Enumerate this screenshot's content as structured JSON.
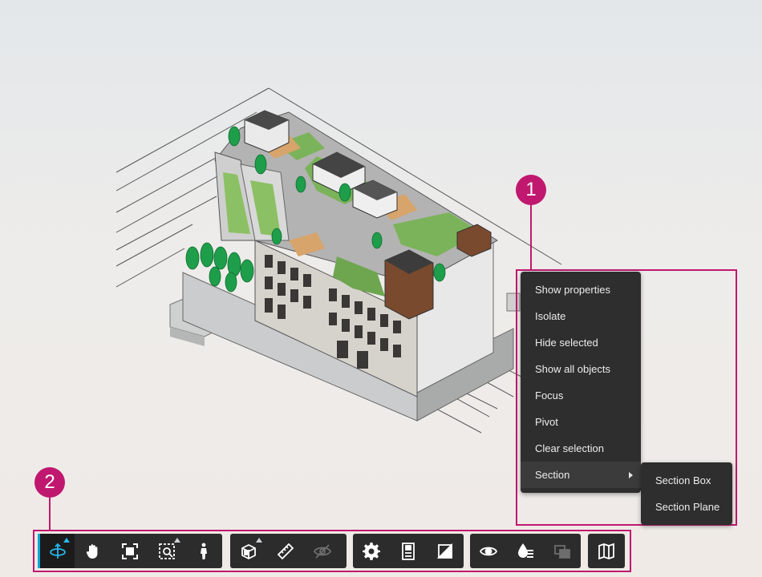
{
  "callouts": {
    "one": "1",
    "two": "2"
  },
  "context_menu": {
    "items": [
      {
        "label": "Show properties"
      },
      {
        "label": "Isolate"
      },
      {
        "label": "Hide selected"
      },
      {
        "label": "Show all objects"
      },
      {
        "label": "Focus"
      },
      {
        "label": "Pivot"
      },
      {
        "label": "Clear selection"
      },
      {
        "label": "Section",
        "has_submenu": true,
        "active": true
      }
    ],
    "submenu": [
      {
        "label": "Section Box"
      },
      {
        "label": "Section Plane"
      }
    ]
  },
  "toolbar": {
    "groups": [
      {
        "name": "navigation",
        "buttons": [
          {
            "icon": "orbit-icon",
            "active": true,
            "has_flyout": true
          },
          {
            "icon": "pan-hand-icon"
          },
          {
            "icon": "fit-to-view-icon"
          },
          {
            "icon": "zoom-window-icon",
            "has_flyout": true
          },
          {
            "icon": "first-person-icon"
          }
        ]
      },
      {
        "name": "tools",
        "buttons": [
          {
            "icon": "section-cube-icon",
            "has_flyout": true
          },
          {
            "icon": "measure-ruler-icon"
          },
          {
            "icon": "hidden-eye-icon",
            "disabled": true
          }
        ]
      },
      {
        "name": "settings",
        "buttons": [
          {
            "icon": "settings-gear-icon"
          },
          {
            "icon": "properties-panel-icon"
          },
          {
            "icon": "full-screen-icon"
          }
        ]
      },
      {
        "name": "visibility",
        "buttons": [
          {
            "icon": "show-eye-icon"
          },
          {
            "icon": "drop-filter-icon"
          },
          {
            "icon": "ghosting-icon",
            "disabled": true
          }
        ]
      },
      {
        "name": "map",
        "buttons": [
          {
            "icon": "map-icon"
          }
        ]
      }
    ]
  },
  "colors": {
    "accent": "#c0186f",
    "active_icon": "#27b8ee",
    "menu_bg": "#2e2e2e",
    "toolbar_bg": "#2c2c2c"
  }
}
